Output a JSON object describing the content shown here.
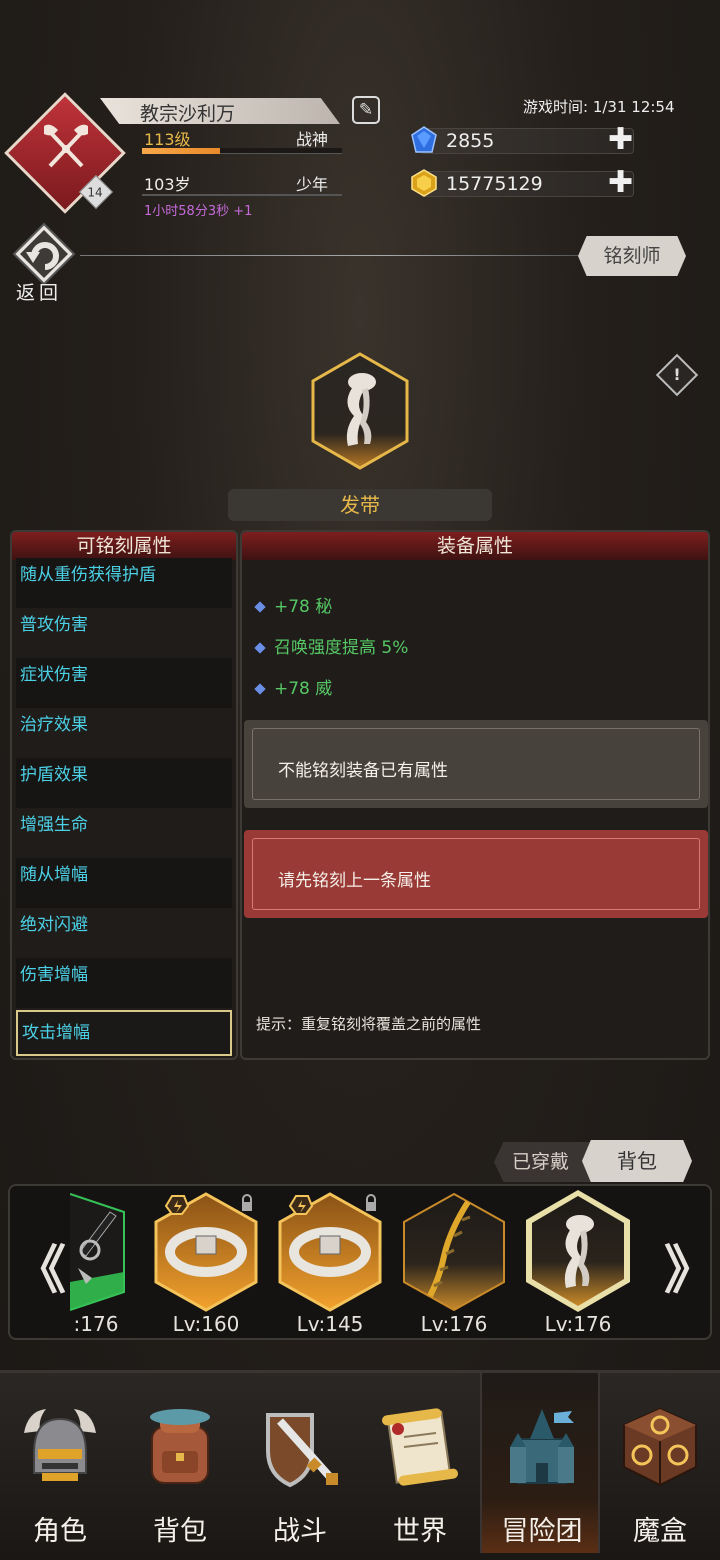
{
  "header": {
    "player_name": "教宗沙利万",
    "level_text": "113级",
    "rank_title": "战神",
    "xp_fraction": 0.39,
    "age_text": "103岁",
    "age_stage": "少年",
    "timer_text": "1小时58分3秒 +1",
    "emblem_level": "14",
    "game_time_label": "游戏时间: 1/31 12:54",
    "diamond_amount": "2855",
    "gold_amount": "15775129",
    "plus_glyph": "✚"
  },
  "nav_top": {
    "back_label": "返回",
    "engraver_label": "铭刻师",
    "warn_glyph": "!"
  },
  "item": {
    "name": "发带"
  },
  "engrave_panel": {
    "title": "可铭刻属性",
    "attributes": [
      "随从重伤获得护盾",
      "普攻伤害",
      "症状伤害",
      "治疗效果",
      "护盾效果",
      "增强生命",
      "随从增幅",
      "绝对闪避",
      "伤害增幅",
      "攻击增幅"
    ]
  },
  "equip_panel": {
    "title": "装备属性",
    "stats": [
      "+78 秘",
      "召唤强度提高 5%",
      "+78 威"
    ],
    "slot_msg_1": "不能铭刻装备已有属性",
    "slot_msg_2": "请先铭刻上一条属性",
    "hint": "提示：重复铭刻将覆盖之前的属性"
  },
  "inventory": {
    "tab_worn": "已穿戴",
    "tab_bag": "背包",
    "prev_glyph": "《",
    "next_glyph": "》",
    "slots": [
      {
        "level": ":176"
      },
      {
        "level": "Lv:160"
      },
      {
        "level": "Lv:145"
      },
      {
        "level": "Lv:176"
      },
      {
        "level": "Lv:176"
      }
    ]
  },
  "bottom_nav": {
    "items": [
      "角色",
      "背包",
      "战斗",
      "世界",
      "冒险团",
      "魔盒"
    ]
  },
  "colors": {
    "accent_gold": "#e6b84a",
    "cyan_text": "#4bd0e6",
    "green_stat": "#56c764",
    "panel_red": "#7e1e1e"
  }
}
